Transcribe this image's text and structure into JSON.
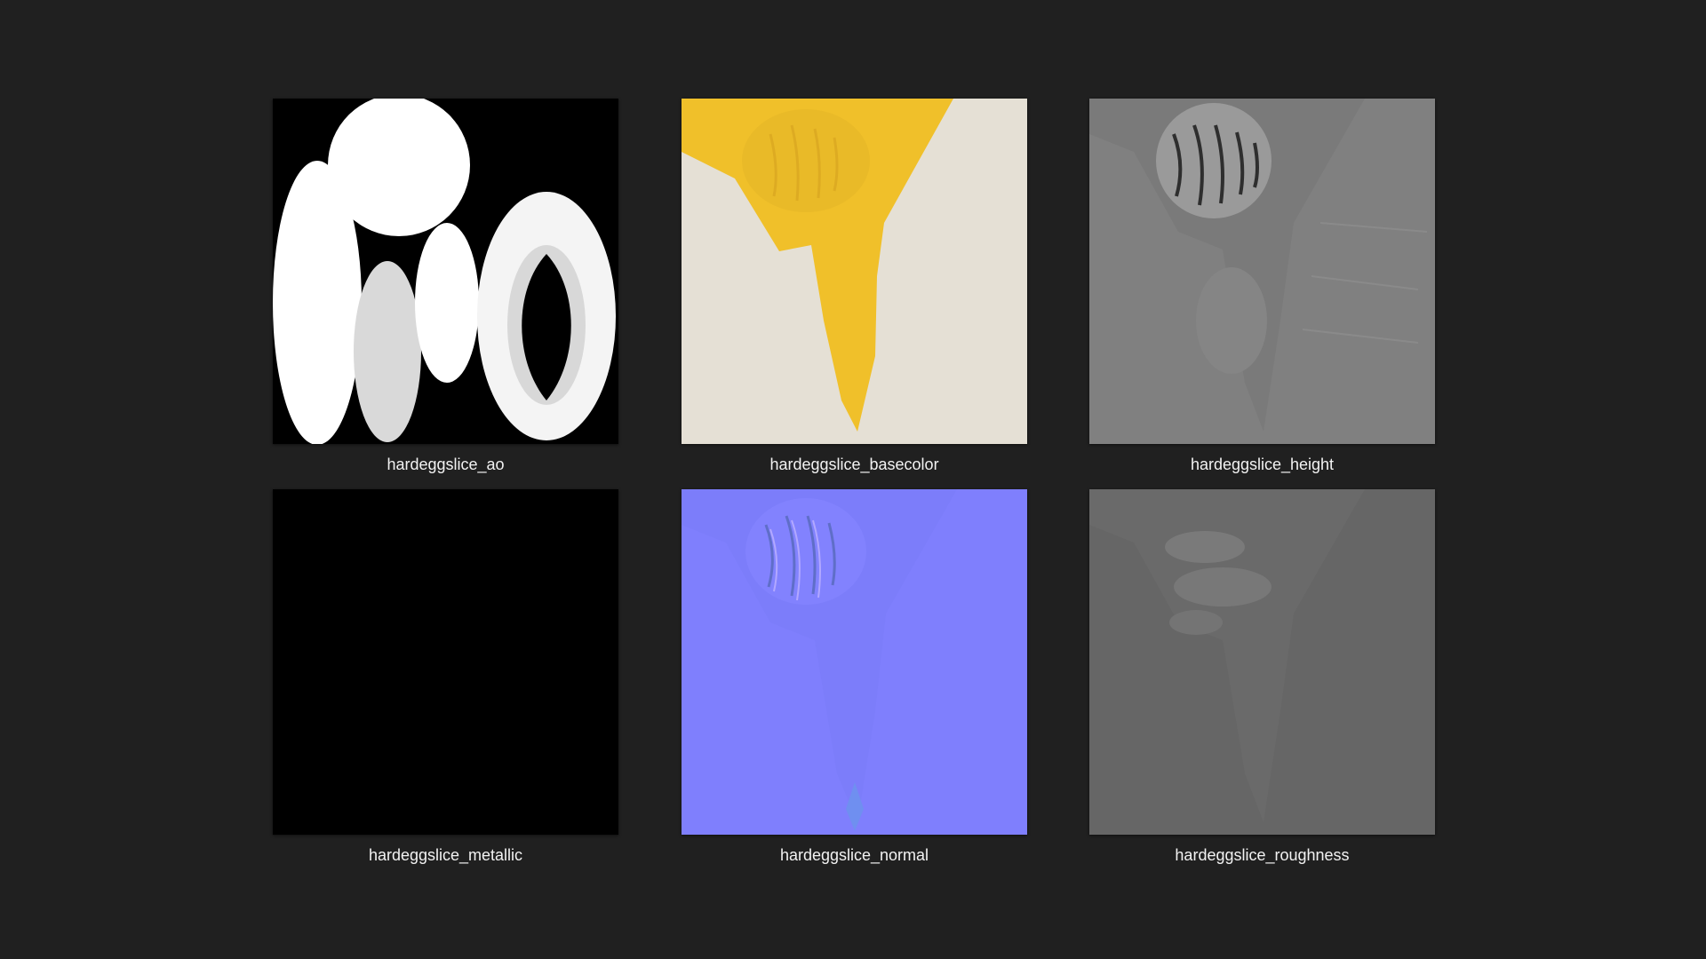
{
  "window": {
    "background": "#202020"
  },
  "thumbnails": [
    {
      "name": "hardeggslice_ao",
      "icon": "ao-map-thumbnail"
    },
    {
      "name": "hardeggslice_basecolor",
      "icon": "basecolor-map-thumbnail"
    },
    {
      "name": "hardeggslice_height",
      "icon": "height-map-thumbnail"
    },
    {
      "name": "hardeggslice_metallic",
      "icon": "metallic-map-thumbnail"
    },
    {
      "name": "hardeggslice_normal",
      "icon": "normal-map-thumbnail"
    },
    {
      "name": "hardeggslice_roughness",
      "icon": "roughness-map-thumbnail"
    }
  ],
  "colors": {
    "label_text": "#f2f2f2",
    "basecolor_yolk": "#f0c02a",
    "basecolor_white": "#e5e0d5",
    "height_gray": "#808080",
    "normal_blue": "#7f7ffd",
    "roughness_gray": "#666666",
    "metallic_black": "#000000"
  }
}
